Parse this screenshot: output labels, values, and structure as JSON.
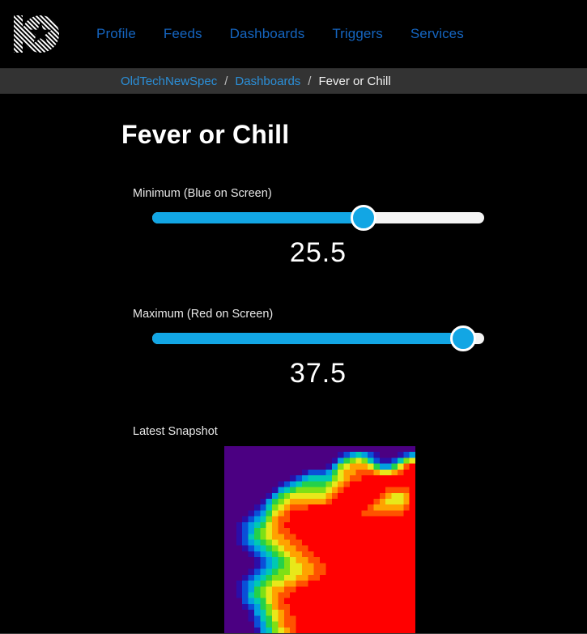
{
  "window": {
    "bg_color": "#000000",
    "accent_color": "#12a6e4",
    "link_color": "#1565c0"
  },
  "navbar": {
    "logo_name": "adafruit-io-logo",
    "links": [
      {
        "label": "Profile",
        "name": "nav-link-profile"
      },
      {
        "label": "Feeds",
        "name": "nav-link-feeds"
      },
      {
        "label": "Dashboards",
        "name": "nav-link-dashboards"
      },
      {
        "label": "Triggers",
        "name": "nav-link-triggers"
      },
      {
        "label": "Services",
        "name": "nav-link-services"
      }
    ]
  },
  "breadcrumb": {
    "items": [
      {
        "label": "OldTechNewSpec",
        "current": false
      },
      {
        "label": "Dashboards",
        "current": false
      },
      {
        "label": "Fever or Chill",
        "current": true
      }
    ],
    "separator": "/"
  },
  "page": {
    "title": "Fever or Chill"
  },
  "controls": [
    {
      "name": "minimum-slider",
      "label": "Minimum (Blue on Screen)",
      "value": "25.5",
      "percent": 63.7
    },
    {
      "name": "maximum-slider",
      "label": "Maximum (Red on Screen)",
      "value": "37.5",
      "percent": 93.7
    }
  ],
  "snapshot": {
    "label": "Latest Snapshot",
    "image_name": "thermal-camera-snapshot",
    "colorbar_name": "temperature-colorbar",
    "grid_size": 32,
    "colormap": [
      "#4b0082",
      "#2b0ea8",
      "#0a4fd8",
      "#00a0e0",
      "#00c8b4",
      "#23d14a",
      "#7ee015",
      "#e8e81a",
      "#ffa200",
      "#ff5200",
      "#ff0000"
    ],
    "chart_data": {
      "type": "heatmap",
      "title": "Latest Snapshot",
      "xlabel": "",
      "ylabel": "",
      "grid": false,
      "legend_position": "bottom",
      "colormap": "jet-like (indigo→blue→cyan→green→yellow→orange→red)",
      "zlim": [
        25.5,
        37.5
      ],
      "rows": 32,
      "cols": 32,
      "values": [
        [
          0,
          0,
          0,
          0,
          0,
          0,
          0,
          0,
          0,
          0,
          0,
          0,
          0,
          0,
          0,
          0,
          0,
          0,
          0,
          0,
          0,
          0,
          0,
          0,
          0,
          0,
          0,
          0,
          0,
          0,
          0,
          0
        ],
        [
          0,
          0,
          0,
          0,
          0,
          0,
          0,
          0,
          0,
          0,
          0,
          0,
          0,
          0,
          0,
          0,
          0,
          0,
          0,
          1,
          2,
          3,
          4,
          3,
          2,
          1,
          0,
          0,
          0,
          1,
          2,
          3
        ],
        [
          0,
          0,
          0,
          0,
          0,
          0,
          0,
          0,
          0,
          0,
          0,
          0,
          0,
          0,
          0,
          0,
          0,
          0,
          1,
          3,
          5,
          6,
          7,
          6,
          4,
          2,
          1,
          1,
          2,
          4,
          6,
          7
        ],
        [
          0,
          0,
          0,
          0,
          0,
          0,
          0,
          0,
          0,
          0,
          0,
          0,
          0,
          0,
          0,
          0,
          0,
          1,
          3,
          6,
          7,
          8,
          8,
          8,
          7,
          5,
          3,
          3,
          5,
          7,
          9,
          10
        ],
        [
          0,
          0,
          0,
          0,
          0,
          0,
          0,
          0,
          0,
          0,
          0,
          0,
          0,
          1,
          2,
          2,
          2,
          3,
          5,
          7,
          8,
          8,
          9,
          9,
          9,
          8,
          7,
          7,
          8,
          9,
          10,
          10
        ],
        [
          0,
          0,
          0,
          0,
          0,
          0,
          0,
          0,
          0,
          0,
          0,
          1,
          2,
          3,
          4,
          4,
          4,
          4,
          6,
          7,
          8,
          9,
          9,
          10,
          10,
          10,
          10,
          10,
          10,
          10,
          10,
          10
        ],
        [
          0,
          0,
          0,
          0,
          0,
          0,
          0,
          0,
          0,
          1,
          2,
          3,
          4,
          5,
          5,
          5,
          5,
          6,
          7,
          8,
          9,
          10,
          10,
          10,
          10,
          10,
          10,
          10,
          10,
          10,
          10,
          10
        ],
        [
          0,
          0,
          0,
          0,
          0,
          0,
          0,
          0,
          1,
          3,
          4,
          5,
          6,
          6,
          6,
          6,
          6,
          7,
          8,
          9,
          10,
          10,
          10,
          10,
          10,
          10,
          10,
          9,
          9,
          9,
          9,
          10
        ],
        [
          0,
          0,
          0,
          0,
          0,
          0,
          0,
          1,
          3,
          5,
          6,
          7,
          7,
          7,
          7,
          7,
          7,
          8,
          9,
          10,
          10,
          10,
          10,
          10,
          10,
          10,
          9,
          8,
          7,
          7,
          8,
          10
        ],
        [
          0,
          0,
          0,
          0,
          0,
          0,
          1,
          3,
          5,
          6,
          7,
          8,
          8,
          8,
          8,
          8,
          8,
          9,
          10,
          10,
          10,
          10,
          10,
          10,
          10,
          9,
          8,
          7,
          7,
          7,
          8,
          10
        ],
        [
          0,
          0,
          0,
          0,
          0,
          1,
          2,
          4,
          6,
          7,
          8,
          9,
          9,
          9,
          10,
          10,
          10,
          10,
          10,
          10,
          10,
          10,
          10,
          10,
          9,
          8,
          8,
          8,
          8,
          8,
          9,
          10
        ],
        [
          0,
          0,
          0,
          0,
          1,
          2,
          3,
          5,
          7,
          8,
          9,
          10,
          10,
          10,
          10,
          10,
          10,
          10,
          10,
          10,
          10,
          10,
          10,
          9,
          9,
          9,
          9,
          9,
          9,
          9,
          10,
          10
        ],
        [
          0,
          0,
          0,
          1,
          2,
          3,
          4,
          6,
          8,
          9,
          9,
          10,
          10,
          10,
          10,
          10,
          10,
          10,
          10,
          10,
          10,
          10,
          10,
          10,
          10,
          10,
          10,
          10,
          10,
          10,
          10,
          10
        ],
        [
          0,
          0,
          1,
          2,
          3,
          4,
          5,
          7,
          8,
          9,
          10,
          10,
          10,
          10,
          10,
          10,
          10,
          10,
          10,
          10,
          10,
          10,
          10,
          10,
          10,
          10,
          10,
          10,
          10,
          10,
          10,
          10
        ],
        [
          0,
          0,
          1,
          2,
          3,
          5,
          6,
          7,
          8,
          9,
          9,
          10,
          10,
          10,
          10,
          10,
          10,
          10,
          10,
          10,
          10,
          10,
          10,
          10,
          10,
          10,
          10,
          10,
          10,
          10,
          10,
          10
        ],
        [
          0,
          0,
          1,
          2,
          4,
          5,
          6,
          7,
          8,
          8,
          9,
          9,
          10,
          10,
          10,
          10,
          10,
          10,
          10,
          10,
          10,
          10,
          10,
          10,
          10,
          10,
          10,
          10,
          10,
          10,
          10,
          10
        ],
        [
          0,
          0,
          1,
          2,
          3,
          4,
          5,
          6,
          7,
          8,
          8,
          9,
          9,
          10,
          10,
          10,
          10,
          10,
          10,
          10,
          10,
          10,
          10,
          10,
          10,
          10,
          10,
          10,
          10,
          10,
          10,
          10
        ],
        [
          0,
          0,
          0,
          1,
          2,
          3,
          4,
          5,
          6,
          7,
          8,
          8,
          9,
          9,
          10,
          10,
          10,
          10,
          10,
          10,
          10,
          10,
          10,
          10,
          10,
          10,
          10,
          10,
          10,
          10,
          10,
          10
        ],
        [
          0,
          0,
          0,
          0,
          1,
          2,
          3,
          4,
          5,
          6,
          7,
          8,
          8,
          9,
          9,
          10,
          10,
          10,
          10,
          10,
          10,
          10,
          10,
          10,
          10,
          10,
          10,
          10,
          10,
          10,
          10,
          10
        ],
        [
          0,
          0,
          0,
          0,
          0,
          1,
          2,
          3,
          4,
          5,
          6,
          7,
          8,
          8,
          9,
          9,
          10,
          10,
          10,
          10,
          10,
          10,
          10,
          10,
          10,
          10,
          10,
          10,
          10,
          10,
          10,
          10
        ],
        [
          0,
          0,
          0,
          0,
          0,
          1,
          2,
          3,
          4,
          5,
          6,
          7,
          7,
          8,
          8,
          9,
          9,
          10,
          10,
          10,
          10,
          10,
          10,
          10,
          10,
          10,
          10,
          10,
          10,
          10,
          10,
          10
        ],
        [
          0,
          0,
          0,
          0,
          1,
          2,
          3,
          4,
          5,
          6,
          6,
          7,
          7,
          8,
          8,
          9,
          9,
          10,
          10,
          10,
          10,
          10,
          10,
          10,
          10,
          10,
          10,
          10,
          10,
          10,
          10,
          10
        ],
        [
          0,
          0,
          0,
          1,
          2,
          3,
          4,
          5,
          6,
          6,
          7,
          7,
          8,
          8,
          9,
          9,
          10,
          10,
          10,
          10,
          10,
          10,
          10,
          10,
          10,
          10,
          10,
          10,
          10,
          10,
          10,
          10
        ],
        [
          0,
          0,
          1,
          2,
          3,
          4,
          5,
          6,
          7,
          7,
          8,
          8,
          9,
          9,
          10,
          10,
          10,
          10,
          10,
          10,
          10,
          10,
          10,
          10,
          10,
          10,
          10,
          10,
          10,
          10,
          10,
          10
        ],
        [
          0,
          0,
          1,
          2,
          3,
          5,
          6,
          7,
          8,
          8,
          9,
          9,
          10,
          10,
          10,
          10,
          10,
          10,
          10,
          10,
          10,
          10,
          10,
          10,
          10,
          10,
          10,
          10,
          10,
          10,
          10,
          10
        ],
        [
          0,
          0,
          1,
          2,
          4,
          5,
          6,
          7,
          8,
          9,
          9,
          10,
          10,
          10,
          10,
          10,
          10,
          10,
          10,
          10,
          10,
          10,
          10,
          10,
          10,
          10,
          10,
          10,
          10,
          10,
          10,
          10
        ],
        [
          0,
          0,
          0,
          2,
          3,
          4,
          5,
          7,
          8,
          9,
          10,
          10,
          10,
          10,
          10,
          10,
          10,
          10,
          10,
          10,
          10,
          10,
          10,
          10,
          10,
          10,
          10,
          10,
          10,
          10,
          10,
          10
        ],
        [
          0,
          0,
          0,
          1,
          2,
          3,
          5,
          6,
          8,
          9,
          9,
          10,
          10,
          10,
          10,
          10,
          10,
          10,
          10,
          10,
          10,
          10,
          10,
          10,
          10,
          10,
          10,
          10,
          10,
          10,
          10,
          10
        ],
        [
          0,
          0,
          0,
          0,
          1,
          3,
          4,
          6,
          7,
          8,
          9,
          10,
          10,
          10,
          10,
          10,
          10,
          10,
          10,
          10,
          10,
          10,
          10,
          10,
          10,
          10,
          10,
          10,
          10,
          10,
          10,
          10
        ],
        [
          0,
          0,
          0,
          0,
          1,
          2,
          4,
          5,
          7,
          8,
          9,
          9,
          10,
          10,
          10,
          10,
          10,
          10,
          10,
          10,
          10,
          10,
          10,
          10,
          10,
          10,
          10,
          10,
          10,
          10,
          10,
          10
        ],
        [
          0,
          0,
          0,
          0,
          0,
          2,
          3,
          5,
          6,
          8,
          9,
          9,
          10,
          10,
          10,
          10,
          10,
          10,
          10,
          10,
          10,
          10,
          10,
          10,
          10,
          10,
          10,
          10,
          10,
          10,
          10,
          10
        ],
        [
          0,
          0,
          0,
          0,
          0,
          1,
          3,
          4,
          6,
          7,
          8,
          9,
          10,
          10,
          10,
          10,
          10,
          10,
          10,
          10,
          10,
          10,
          10,
          10,
          10,
          10,
          10,
          10,
          10,
          10,
          10,
          10
        ]
      ]
    }
  }
}
